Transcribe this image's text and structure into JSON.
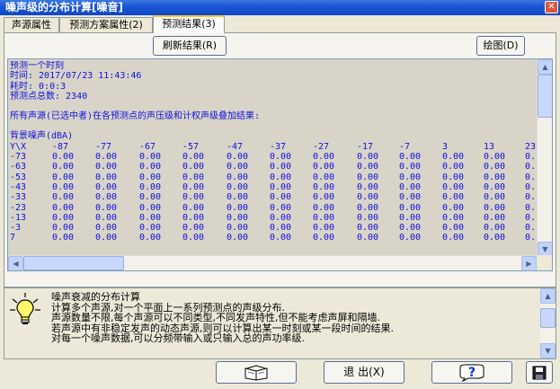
{
  "window": {
    "title": "噪声级的分布计算[噪音]"
  },
  "tabs": [
    {
      "label": "声源属性"
    },
    {
      "label": "预测方案属性(2)"
    },
    {
      "label": "预测结果(3)"
    }
  ],
  "toolbar": {
    "refresh_label": "刷新结果(R)",
    "plot_label": "绘图(D)"
  },
  "results": {
    "header_lines": [
      "预测一个时刻",
      "时间: 2017/07/23 11:43:46",
      "耗时: 0:0:3",
      "预测点总数: 2340"
    ],
    "summary_line": "所有声源(已选中者)在各预测点的声压级和计权声级叠加结果:",
    "section_title": "背景噪声(dBA)",
    "axis_label": "Y\\X",
    "columns": [
      "-87",
      "-77",
      "-67",
      "-57",
      "-47",
      "-37",
      "-27",
      "-17",
      "-7",
      "3",
      "13",
      "23"
    ],
    "rows": [
      {
        "y": "-73",
        "values": [
          "0.00",
          "0.00",
          "0.00",
          "0.00",
          "0.00",
          "0.00",
          "0.00",
          "0.00",
          "0.00",
          "0.00",
          "0.00",
          "0."
        ]
      },
      {
        "y": "-63",
        "values": [
          "0.00",
          "0.00",
          "0.00",
          "0.00",
          "0.00",
          "0.00",
          "0.00",
          "0.00",
          "0.00",
          "0.00",
          "0.00",
          "0."
        ]
      },
      {
        "y": "-53",
        "values": [
          "0.00",
          "0.00",
          "0.00",
          "0.00",
          "0.00",
          "0.00",
          "0.00",
          "0.00",
          "0.00",
          "0.00",
          "0.00",
          "0."
        ]
      },
      {
        "y": "-43",
        "values": [
          "0.00",
          "0.00",
          "0.00",
          "0.00",
          "0.00",
          "0.00",
          "0.00",
          "0.00",
          "0.00",
          "0.00",
          "0.00",
          "0."
        ]
      },
      {
        "y": "-33",
        "values": [
          "0.00",
          "0.00",
          "0.00",
          "0.00",
          "0.00",
          "0.00",
          "0.00",
          "0.00",
          "0.00",
          "0.00",
          "0.00",
          "0."
        ]
      },
      {
        "y": "-23",
        "values": [
          "0.00",
          "0.00",
          "0.00",
          "0.00",
          "0.00",
          "0.00",
          "0.00",
          "0.00",
          "0.00",
          "0.00",
          "0.00",
          "0."
        ]
      },
      {
        "y": "-13",
        "values": [
          "0.00",
          "0.00",
          "0.00",
          "0.00",
          "0.00",
          "0.00",
          "0.00",
          "0.00",
          "0.00",
          "0.00",
          "0.00",
          "0."
        ]
      },
      {
        "y": "-3",
        "values": [
          "0.00",
          "0.00",
          "0.00",
          "0.00",
          "0.00",
          "0.00",
          "0.00",
          "0.00",
          "0.00",
          "0.00",
          "0.00",
          "0."
        ]
      },
      {
        "y": "7",
        "values": [
          "0.00",
          "0.00",
          "0.00",
          "0.00",
          "0.00",
          "0.00",
          "0.00",
          "0.00",
          "0.00",
          "0.00",
          "0.00",
          "0."
        ]
      }
    ]
  },
  "help": {
    "icon": "lightbulb-icon",
    "lines": [
      "噪声衰减的分布计算",
      "计算多个声源,对一个平面上一系列预测点的声级分布.",
      "声源数量不限,每个声源可以不同类型,不同发声特性,但不能考虑声屏和隔墙.",
      "若声源中有非稳定发声的动态声源,则可以计算出某一时刻或某一段时间的结果.",
      "对每一个噪声数据,可以分频带输入或只输入总的声功率级."
    ]
  },
  "bottom": {
    "book_icon": "book-icon",
    "exit_label": "退 出(X)",
    "help_icon": "question-icon",
    "save_icon": "floppy-disk-icon"
  }
}
